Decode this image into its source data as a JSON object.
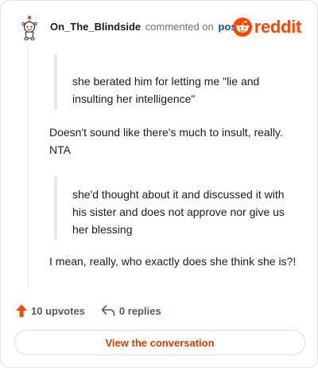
{
  "header": {
    "username": "On_The_Blindside",
    "action_text": "commented on",
    "post_link": "post",
    "brand_wordmark": "reddit"
  },
  "comment": {
    "quote1": "she berated him for letting me \"lie and insulting her intelligence\"",
    "paragraph1": "Doesn't sound like there's much to insult, really. NTA",
    "quote2": "she'd thought about it and discussed it with his sister and does not approve nor give us her blessing",
    "paragraph2": "I mean, really, who exactly does she think she is?!"
  },
  "footer": {
    "upvotes": "10 upvotes",
    "replies": "0 replies"
  },
  "cta_label": "View the conversation",
  "colors": {
    "brand_orange": "#ff4500",
    "link_blue": "#0a4f9e",
    "cta_text": "#d93a00"
  },
  "icons": {
    "avatar": "snoo-avatar",
    "logo": "reddit-logo-icon",
    "upvote": "upvote-arrow-icon",
    "reply": "reply-arrow-icon"
  }
}
